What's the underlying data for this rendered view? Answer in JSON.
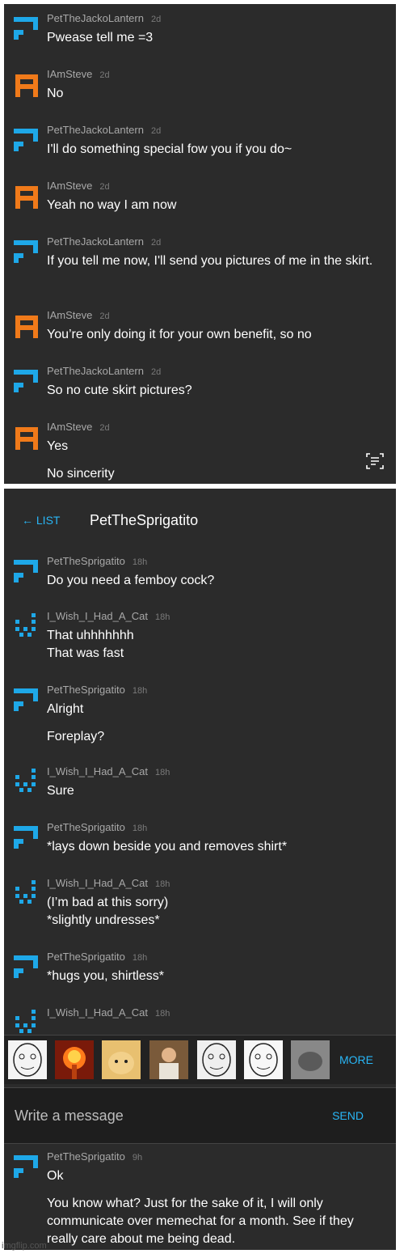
{
  "panel1": {
    "messages": [
      {
        "user": "PetTheJackoLantern",
        "time": "2d",
        "avatar": "blue",
        "lines": [
          "Pwease tell me =3"
        ]
      },
      {
        "user": "IAmSteve",
        "time": "2d",
        "avatar": "orange",
        "lines": [
          "No"
        ]
      },
      {
        "user": "PetTheJackoLantern",
        "time": "2d",
        "avatar": "blue",
        "lines": [
          "I'll do something special fow you if you do~"
        ]
      },
      {
        "user": "IAmSteve",
        "time": "2d",
        "avatar": "orange",
        "lines": [
          "Yeah no way I am now"
        ]
      },
      {
        "user": "PetTheJackoLantern",
        "time": "2d",
        "avatar": "blue",
        "lines": [
          "If you tell me now, I'll send you pictures of me in the skirt."
        ]
      },
      {
        "user": "IAmSteve",
        "time": "2d",
        "avatar": "orange",
        "lines": [
          "You’re only doing it for your own benefit, so no"
        ]
      },
      {
        "user": "PetTheJackoLantern",
        "time": "2d",
        "avatar": "blue",
        "lines": [
          "So no cute skirt pictures?"
        ]
      },
      {
        "user": "IAmSteve",
        "time": "2d",
        "avatar": "orange",
        "lines": [
          "Yes",
          "No sincerity"
        ]
      }
    ]
  },
  "panel2": {
    "header": {
      "back_label": "← LIST",
      "title": "PetTheSprigatito"
    },
    "messages": [
      {
        "user": "PetTheSprigatito",
        "time": "18h",
        "avatar": "blue",
        "lines": [
          "Do you need a femboy cock?"
        ]
      },
      {
        "user": "I_Wish_I_Had_A_Cat",
        "time": "18h",
        "avatar": "dots",
        "lines": [
          "That uhhhhhhh",
          "That was fast"
        ]
      },
      {
        "user": "PetTheSprigatito",
        "time": "18h",
        "avatar": "blue",
        "lines": [
          "Alright",
          "Foreplay?"
        ]
      },
      {
        "user": "I_Wish_I_Had_A_Cat",
        "time": "18h",
        "avatar": "dots",
        "lines": [
          "Sure"
        ]
      },
      {
        "user": "PetTheSprigatito",
        "time": "18h",
        "avatar": "blue",
        "lines": [
          "*lays down beside you and removes shirt*"
        ]
      },
      {
        "user": "I_Wish_I_Had_A_Cat",
        "time": "18h",
        "avatar": "dots",
        "lines": [
          "(I’m bad at this sorry)",
          "*slightly undresses*"
        ]
      },
      {
        "user": "PetTheSprigatito",
        "time": "18h",
        "avatar": "blue",
        "lines": [
          "*hugs you, shirtless*"
        ]
      },
      {
        "user": "I_Wish_I_Had_A_Cat",
        "time": "18h",
        "avatar": "dots",
        "lines": []
      }
    ],
    "stickers": [
      "rage-face",
      "explosion",
      "cat",
      "jesus",
      "okay-face",
      "wojak",
      "cat-photo"
    ],
    "more_label": "MORE",
    "composer": {
      "placeholder": "Write a message",
      "send_label": "SEND"
    },
    "last_message": {
      "user": "PetTheSprigatito",
      "time": "9h",
      "avatar": "blue",
      "lines": [
        "Ok",
        "You know what? Just for the sake of it, I will only communicate over memechat for a month. See if they really care about me being dead."
      ]
    }
  },
  "colors": {
    "panel_bg": "#2b2b2b",
    "accent": "#29b6f6",
    "blue_avatar": "#1ea8e8",
    "orange_avatar": "#f07a1a"
  },
  "watermark": "imgflip.com"
}
